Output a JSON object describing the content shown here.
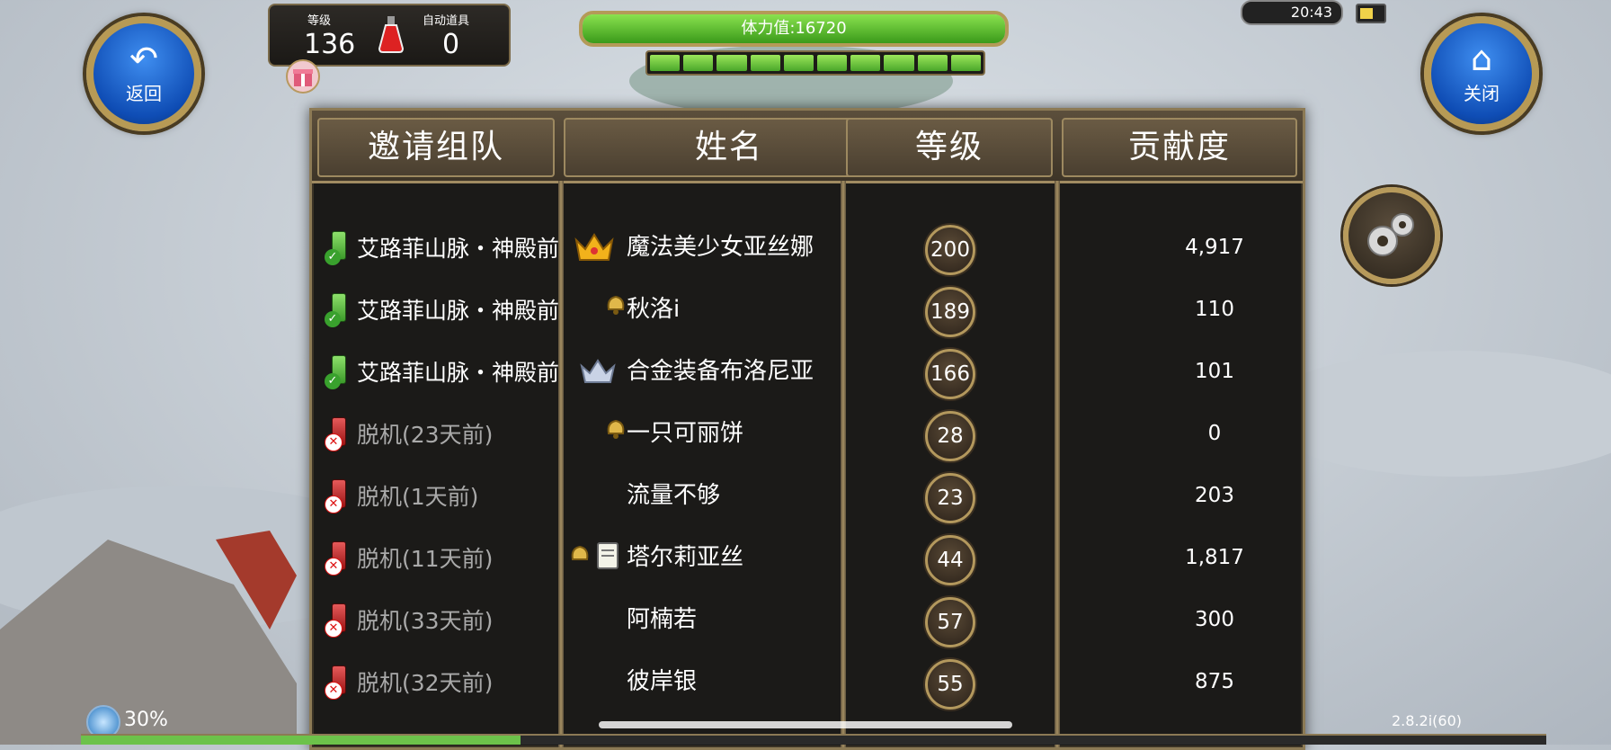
{
  "hud": {
    "back_label": "返回",
    "close_label": "关闭",
    "level_title": "等级",
    "level_value": "136",
    "auto_item_title": "自动道具",
    "auto_item_value": "0",
    "stamina_text": "体力值:16720",
    "stamina_fill": 1.0,
    "clock": "20:43",
    "bottom_percent": "30%",
    "version": "2.8.2i(60)"
  },
  "table": {
    "headers": [
      "邀请组队",
      "姓名",
      "等级",
      "贡献度"
    ],
    "rows": [
      {
        "status": "艾路菲山脉・神殿前",
        "online": true,
        "rank_icon": "gold-crown-icon",
        "name": "魔法美少女亚丝娜",
        "level": "200",
        "contribution": "4,917"
      },
      {
        "status": "艾路菲山脉・神殿前",
        "online": true,
        "rank_icon": "bell-icon",
        "name": "秋洛i",
        "level": "189",
        "contribution": "110"
      },
      {
        "status": "艾路菲山脉・神殿前",
        "online": true,
        "rank_icon": "silver-crown-icon",
        "name": "合金装备布洛尼亚",
        "level": "166",
        "contribution": "101"
      },
      {
        "status": "脱机(23天前)",
        "online": false,
        "rank_icon": "bell-icon",
        "name": "一只可丽饼",
        "level": "28",
        "contribution": "0"
      },
      {
        "status": "脱机(1天前)",
        "online": false,
        "rank_icon": "",
        "name": "流量不够",
        "level": "23",
        "contribution": "203"
      },
      {
        "status": "脱机(11天前)",
        "online": false,
        "rank_icon": "bell-memo-icon",
        "name": "塔尔莉亚丝",
        "level": "44",
        "contribution": "1,817"
      },
      {
        "status": "脱机(33天前)",
        "online": false,
        "rank_icon": "",
        "name": "阿楠若",
        "level": "57",
        "contribution": "300"
      },
      {
        "status": "脱机(32天前)",
        "online": false,
        "rank_icon": "",
        "name": "彼岸银",
        "level": "55",
        "contribution": "875"
      }
    ]
  }
}
